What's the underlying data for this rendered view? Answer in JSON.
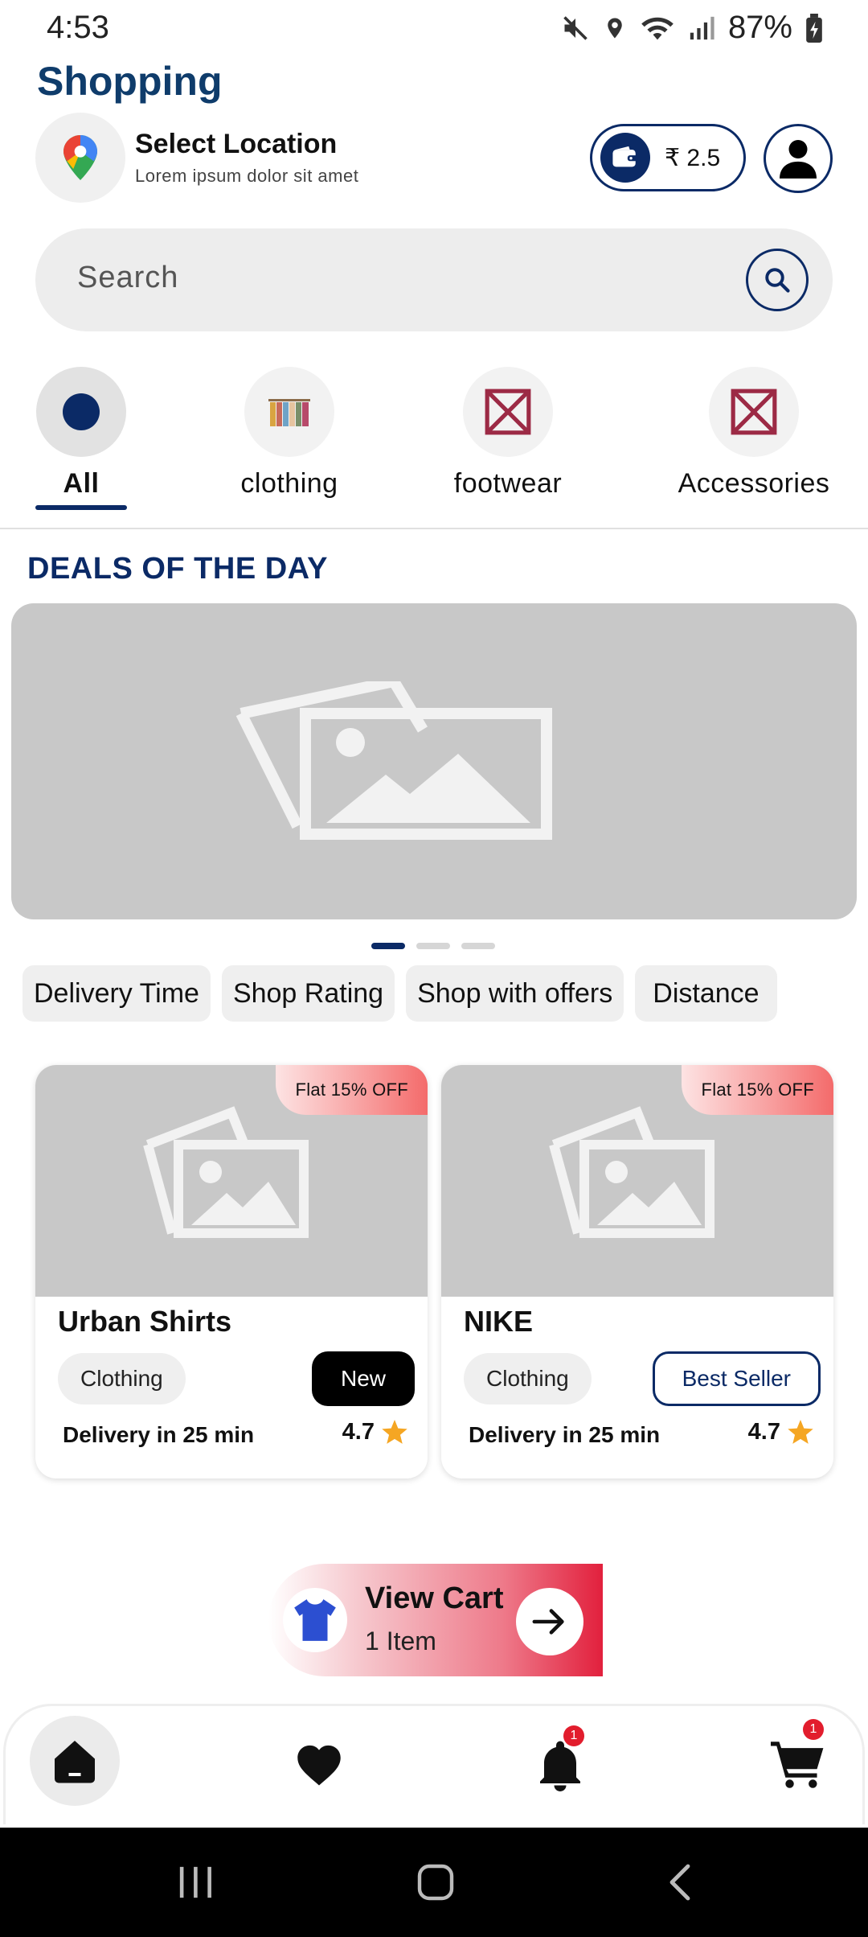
{
  "status": {
    "time": "4:53",
    "battery": "87%"
  },
  "app": {
    "title": "Shopping"
  },
  "location": {
    "title": "Select Location",
    "subtitle": "Lorem ipsum dolor sit amet"
  },
  "wallet": {
    "amount": "₹ 2.5"
  },
  "search": {
    "placeholder": "Search"
  },
  "categories": [
    {
      "label": "All",
      "active": true,
      "icon": "dot-icon"
    },
    {
      "label": "clothing",
      "active": false,
      "icon": "clothing-icon"
    },
    {
      "label": "footwear",
      "active": false,
      "icon": "broken-image-icon"
    },
    {
      "label": "Accessories",
      "active": false,
      "icon": "broken-image-icon"
    }
  ],
  "deals": {
    "title": "DEALS OF THE DAY",
    "slides": 3,
    "active_slide": 1
  },
  "filters": [
    "Delivery Time",
    "Shop Rating",
    "Shop with offers",
    "Distance"
  ],
  "products": [
    {
      "name": "Urban Shirts",
      "offer": "Flat 15% OFF",
      "category": "Clothing",
      "tag": "New",
      "delivery": "Delivery in 25 min",
      "rating": "4.7"
    },
    {
      "name": "NIKE",
      "offer": "Flat 15% OFF",
      "category": "Clothing",
      "tag": "Best Seller",
      "delivery": "Delivery in 25 min",
      "rating": "4.7"
    }
  ],
  "cart": {
    "title": "View Cart",
    "subtitle": "1 Item"
  },
  "nav": {
    "notifications_badge": "1",
    "cart_badge": "1"
  },
  "colors": {
    "primary": "#0b2a66",
    "title": "#0f3c6b",
    "accent_red": "#e2203d",
    "star": "#f5a623"
  }
}
